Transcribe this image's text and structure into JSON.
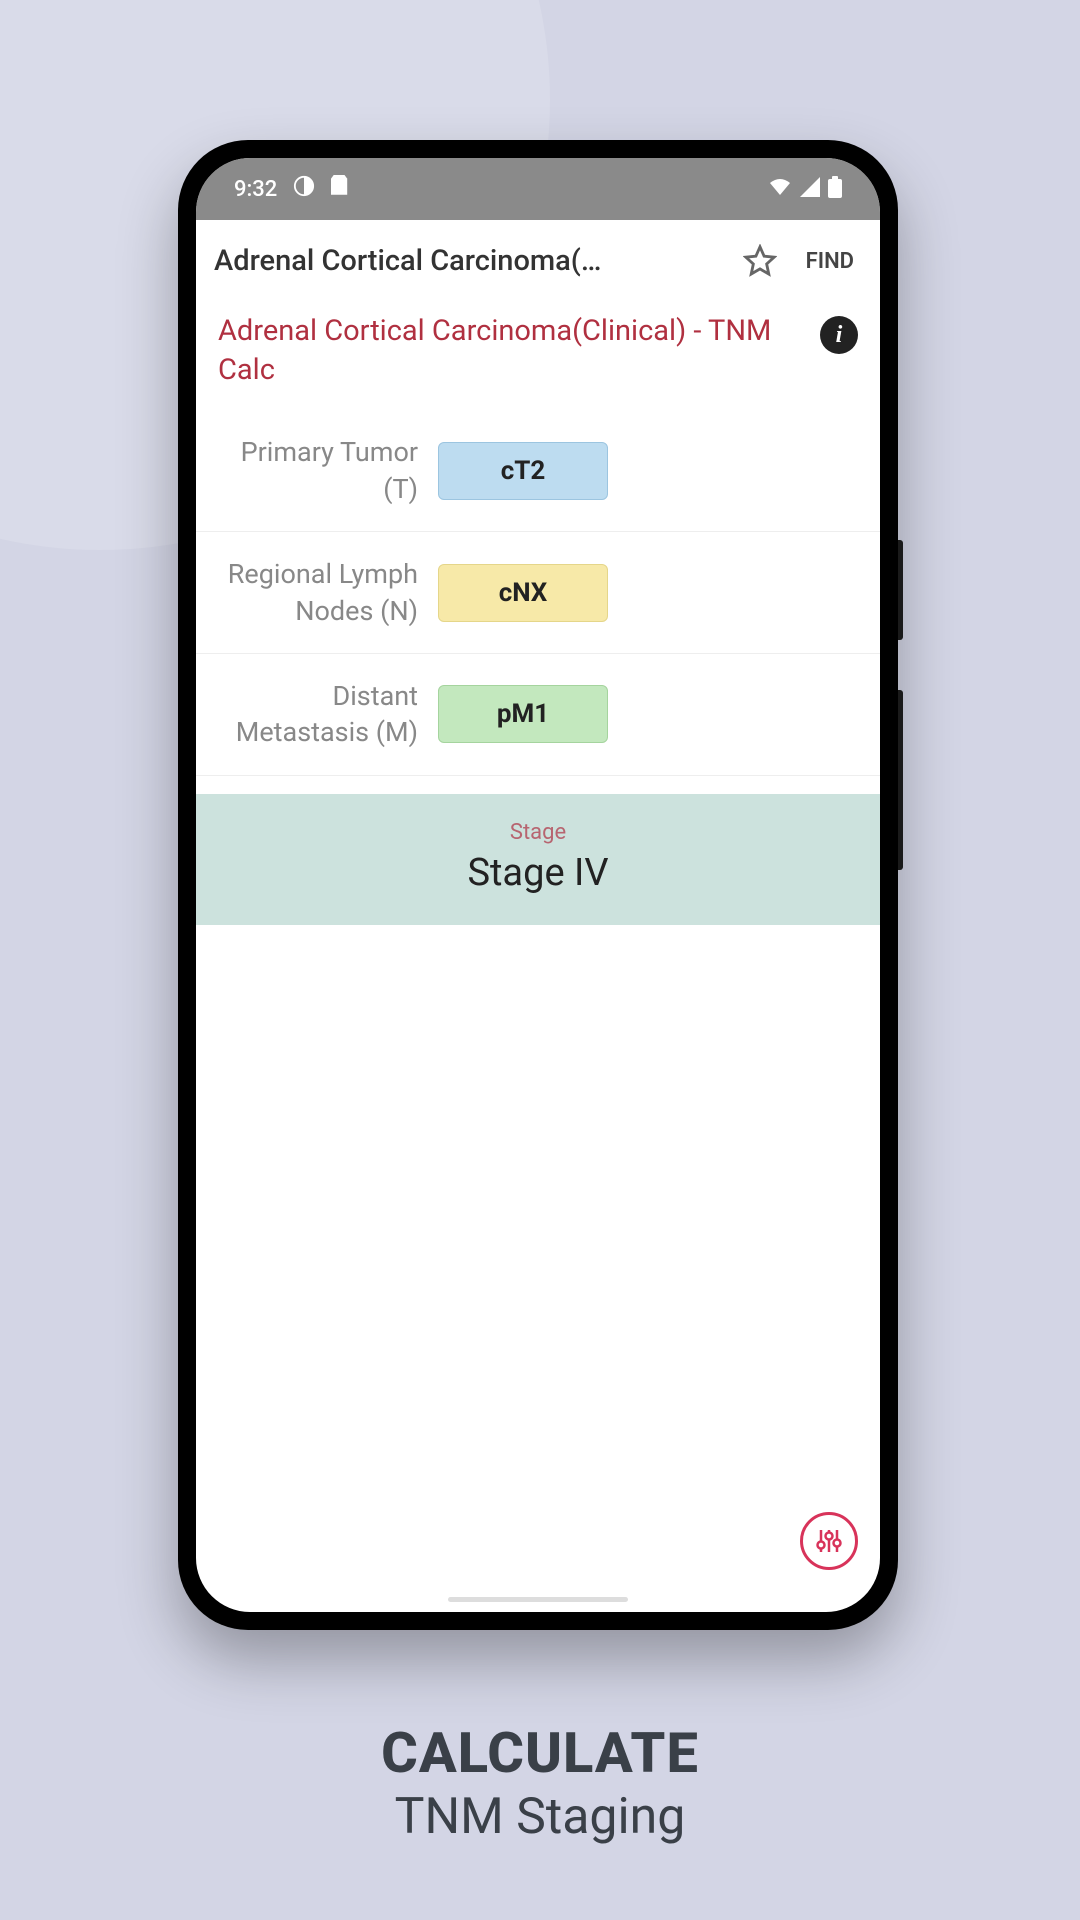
{
  "status": {
    "time": "9:32"
  },
  "app_bar": {
    "title": "Adrenal Cortical Carcinoma(…",
    "find_label": "FIND"
  },
  "subtitle": "Adrenal Cortical Carcinoma(Clinical) - TNM Calc",
  "params": {
    "t": {
      "label": "Primary Tumor (T)",
      "value": "cT2"
    },
    "n": {
      "label": "Regional Lymph Nodes (N)",
      "value": "cNX"
    },
    "m": {
      "label": "Distant Metastasis (M)",
      "value": "pM1"
    }
  },
  "result": {
    "label": "Stage",
    "value": "Stage IV"
  },
  "marketing": {
    "line1": "CALCULATE",
    "line2": "TNM Staging"
  }
}
